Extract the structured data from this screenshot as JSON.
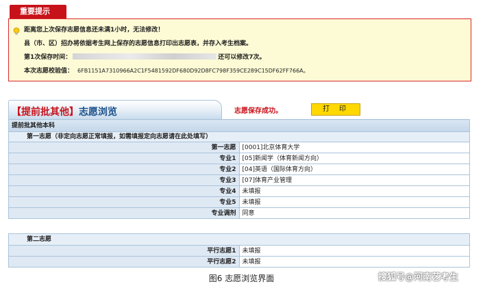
{
  "notice": {
    "tab_label": "重要提示",
    "line1": "距离您上次保存志愿信息还未满1小时，无法修改！",
    "line2": "县（市、区）招办将依据考生网上保存的志愿信息打印出志愿表，并存入考生档案。",
    "line3_prefix": "第1次保存时间：",
    "line3_suffix": "还可以修改7次。",
    "line4_label": "本次志愿校验值：",
    "line4_value": "6FB1151A7310966A2C1F5481592DF680D92D8FC798F359CE289C15DF62FF766A。"
  },
  "header": {
    "title_bracket": "【提前批其他】",
    "title_main": "志愿浏览",
    "save_message": "志愿保存成功。",
    "print_label": "打印"
  },
  "section1": {
    "band": "提前批其他本科",
    "group": "第一志愿（非定向志愿正常填报，如需填报定向志愿请在此处填写）",
    "rows": [
      {
        "label": "第一志愿",
        "value": "[0001]北京体育大学"
      },
      {
        "label": "专业1",
        "value": "[05]新闻学（体育新闻方向）"
      },
      {
        "label": "专业2",
        "value": "[04]英语（国际体育方向）"
      },
      {
        "label": "专业3",
        "value": "[07]体育产业管理"
      },
      {
        "label": "专业4",
        "value": "未填报"
      },
      {
        "label": "专业5",
        "value": "未填报"
      },
      {
        "label": "专业调剂",
        "value": "同意"
      }
    ]
  },
  "section2": {
    "group": "第二志愿",
    "rows": [
      {
        "label": "平行志愿1",
        "value": "未填报"
      },
      {
        "label": "平行志愿2",
        "value": "未填报"
      }
    ]
  },
  "caption": "图6 志愿浏览界面",
  "watermark": "搜狐号@河南艺考生",
  "colors": {
    "accent_red": "#c8121a",
    "notice_bg": "#fdfbd6",
    "table_border": "#a9c3da",
    "button_yellow": "#ffd800"
  }
}
